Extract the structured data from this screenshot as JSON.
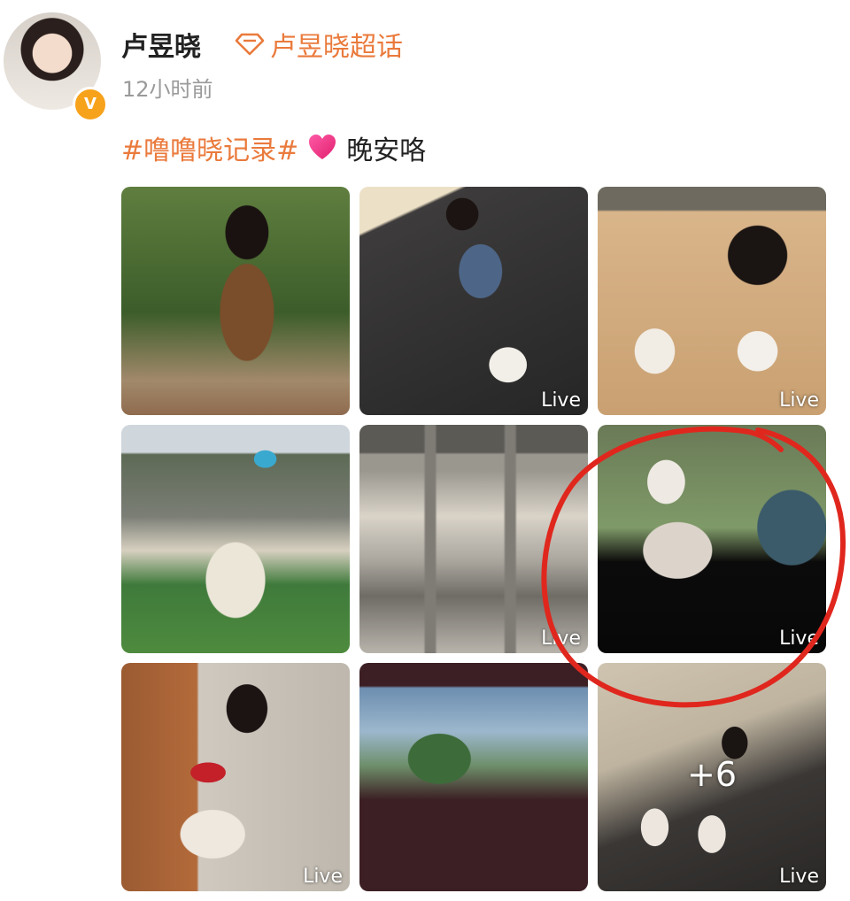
{
  "header": {
    "name": "卢昱晓",
    "topic_link": "卢昱晓超话",
    "time": "12小时前"
  },
  "post": {
    "hashtag": "#噜噜晓记录#",
    "text": "晚安咯"
  },
  "photos": [
    {
      "live": ""
    },
    {
      "live": "Live"
    },
    {
      "live": "Live"
    },
    {
      "live": ""
    },
    {
      "live": "Live"
    },
    {
      "live": "Live"
    },
    {
      "live": "Live"
    },
    {
      "live": ""
    },
    {
      "live": "Live",
      "more": "+6"
    }
  ],
  "colors": {
    "accent": "#ea7a3c",
    "verified_badge": "#f7a21b",
    "annotation_circle": "#e0271e"
  }
}
